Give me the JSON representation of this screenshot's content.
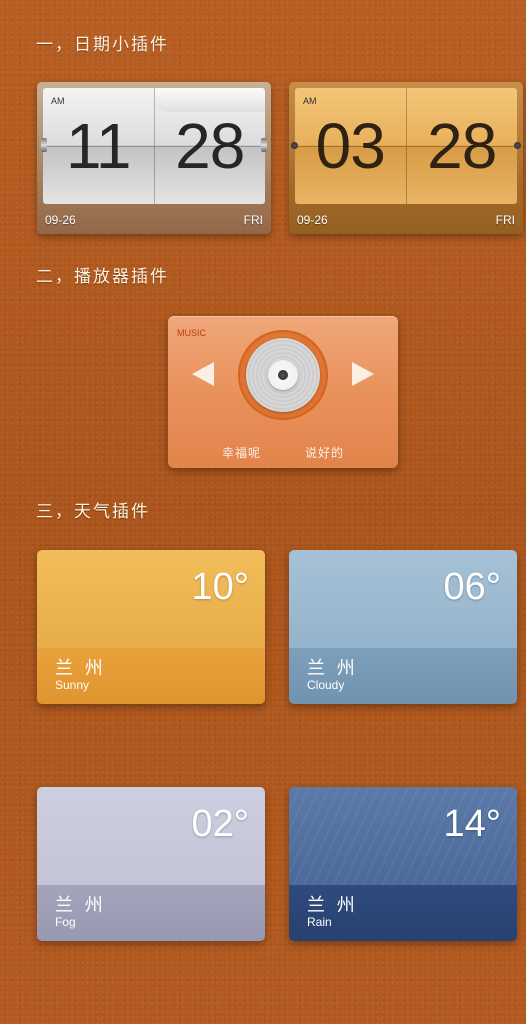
{
  "sections": {
    "date_widgets_title": "一，日期小插件",
    "player_widgets_title": "二，播放器插件",
    "weather_widgets_title": "三，天气插件"
  },
  "clocks": [
    {
      "ampm": "AM",
      "hour": "11",
      "minute": "28",
      "date": "09-26",
      "day": "FRI",
      "style": "silver"
    },
    {
      "ampm": "AM",
      "hour": "03",
      "minute": "28",
      "date": "09-26",
      "day": "FRI",
      "style": "gold"
    }
  ],
  "music": {
    "label": "MUSIC",
    "lyric_left": "幸福呢",
    "lyric_right": "说好的",
    "prev_icon": "triangle-left-icon",
    "next_icon": "triangle-right-icon"
  },
  "weather": [
    {
      "temp": "10°",
      "city": "兰 州",
      "condition": "Sunny",
      "color": "#e9a23d"
    },
    {
      "temp": "06°",
      "city": "兰 州",
      "condition": "Cloudy",
      "color": "#7e9fba"
    },
    {
      "temp": "02°",
      "city": "兰 州",
      "condition": "Fog",
      "color": "#a3a4bc"
    },
    {
      "temp": "14°",
      "city": "兰 州",
      "condition": "Rain",
      "color": "#2f4a7c"
    }
  ],
  "colors": {
    "background": "#b0581f",
    "title_text": "#fff3df",
    "music_accent": "#e89058"
  }
}
